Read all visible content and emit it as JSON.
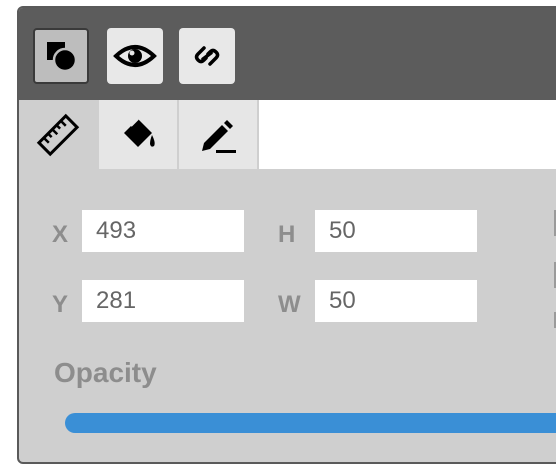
{
  "toolbar": {
    "buttons": [
      {
        "icon": "shapes-icon",
        "active": true
      },
      {
        "icon": "eye-icon",
        "active": false
      },
      {
        "icon": "link-icon",
        "active": false
      }
    ]
  },
  "tabs": [
    {
      "icon": "ruler-icon",
      "active": true
    },
    {
      "icon": "paint-bucket-icon",
      "active": false
    },
    {
      "icon": "pen-icon",
      "active": false
    }
  ],
  "geometry_fields": {
    "x": {
      "label": "X",
      "value": "493"
    },
    "y": {
      "label": "Y",
      "value": "281"
    },
    "h": {
      "label": "H",
      "value": "50"
    },
    "w": {
      "label": "W",
      "value": "50"
    }
  },
  "opacity": {
    "label": "Opacity",
    "value_fraction": 1.0
  },
  "colors": {
    "titlebar": "#5c5c5c",
    "panel": "#cfcfcf",
    "slider": "#3a8fd6"
  }
}
